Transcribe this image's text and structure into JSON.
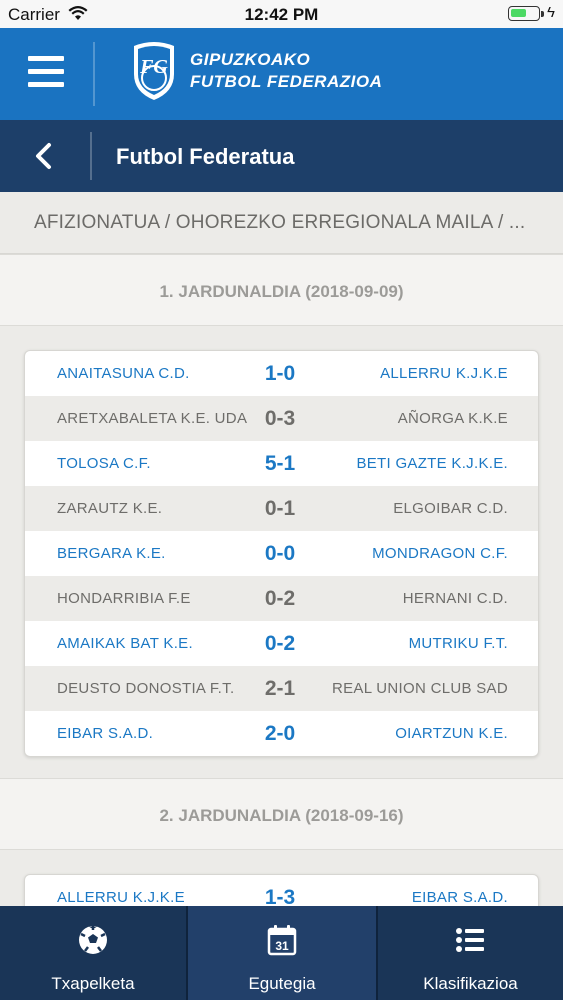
{
  "status_bar": {
    "carrier": "Carrier",
    "time": "12:42 PM",
    "battery_level": 0.6
  },
  "header": {
    "logo_line1": "GIPUZKOAKO",
    "logo_line2": "FUTBOL FEDERAZIOA",
    "brand_color": "#1a73c1"
  },
  "subheader": {
    "title": "Futbol Federatua",
    "color": "#1d3f69"
  },
  "breadcrumb": "AFIZIONATUA / OHOREZKO ERREGIONALA MAILA / ...",
  "rounds": [
    {
      "label": "1. JARDUNALDIA (2018-09-09)",
      "matches": [
        {
          "home": "ANAITASUNA C.D.",
          "score": "1-0",
          "away": "ALLERRU K.J.K.E"
        },
        {
          "home": "ARETXABALETA K.E. UDA",
          "score": "0-3",
          "away": "AÑORGA K.K.E"
        },
        {
          "home": "TOLOSA C.F.",
          "score": "5-1",
          "away": "BETI GAZTE K.J.K.E."
        },
        {
          "home": "ZARAUTZ K.E.",
          "score": "0-1",
          "away": "ELGOIBAR C.D."
        },
        {
          "home": "BERGARA K.E.",
          "score": "0-0",
          "away": "MONDRAGON C.F."
        },
        {
          "home": "HONDARRIBIA F.E",
          "score": "0-2",
          "away": "HERNANI C.D."
        },
        {
          "home": "AMAIKAK BAT K.E.",
          "score": "0-2",
          "away": "MUTRIKU F.T."
        },
        {
          "home": "DEUSTO DONOSTIA F.T.",
          "score": "2-1",
          "away": "REAL UNION CLUB SAD"
        },
        {
          "home": "EIBAR S.A.D.",
          "score": "2-0",
          "away": "OIARTZUN K.E."
        }
      ]
    },
    {
      "label": "2. JARDUNALDIA (2018-09-16)",
      "matches": [
        {
          "home": "ALLERRU K.J.K.E",
          "score": "1-3",
          "away": "EIBAR S.A.D."
        }
      ]
    }
  ],
  "tabs": [
    {
      "label": "Txapelketa",
      "icon": "soccer-ball-icon",
      "active": false
    },
    {
      "label": "Egutegia",
      "icon": "calendar-icon",
      "calendar_day": "31",
      "active": true
    },
    {
      "label": "Klasifikazioa",
      "icon": "list-icon",
      "active": false
    }
  ],
  "colors": {
    "score_blue": "#1b78c4",
    "text_grey": "#6e6d6a",
    "tabbar": "#1a3557"
  }
}
